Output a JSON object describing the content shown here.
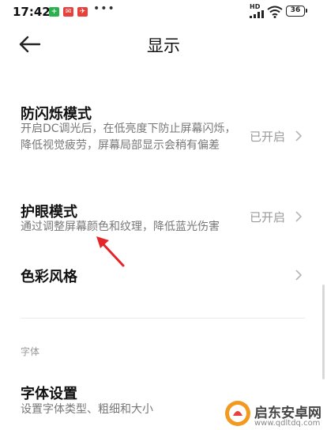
{
  "status_bar": {
    "time": "17:42",
    "dots": "•••",
    "network_label": "HD",
    "battery": "36",
    "notification_icons": [
      {
        "name": "notif-green",
        "color": "#2bb24c"
      },
      {
        "name": "notif-red-1",
        "color": "#e8403a"
      },
      {
        "name": "notif-red-2",
        "color": "#e8403a"
      }
    ]
  },
  "header": {
    "back_icon": "arrow-left-icon",
    "title": "显示"
  },
  "settings": [
    {
      "title": "防闪烁模式",
      "description": "开启DC调光后，在低亮度下防止屏幕闪烁，降低视觉疲劳，屏幕局部显示会稍有偏差",
      "status": "已开启"
    },
    {
      "title": "护眼模式",
      "description": "通过调整屏幕颜色和纹理，降低蓝光伤害",
      "status": "已开启"
    },
    {
      "title": "色彩风格",
      "status": ""
    }
  ],
  "font_section": {
    "label": "字体",
    "title": "字体设置",
    "description": "设置字体类型、粗细和大小"
  },
  "watermark": {
    "name": "启东安卓网",
    "url": "www.qdltdq.com"
  },
  "colors": {
    "annotation_arrow": "#e5252a",
    "text_secondary": "#777777",
    "status_text": "#9a9a9a"
  }
}
